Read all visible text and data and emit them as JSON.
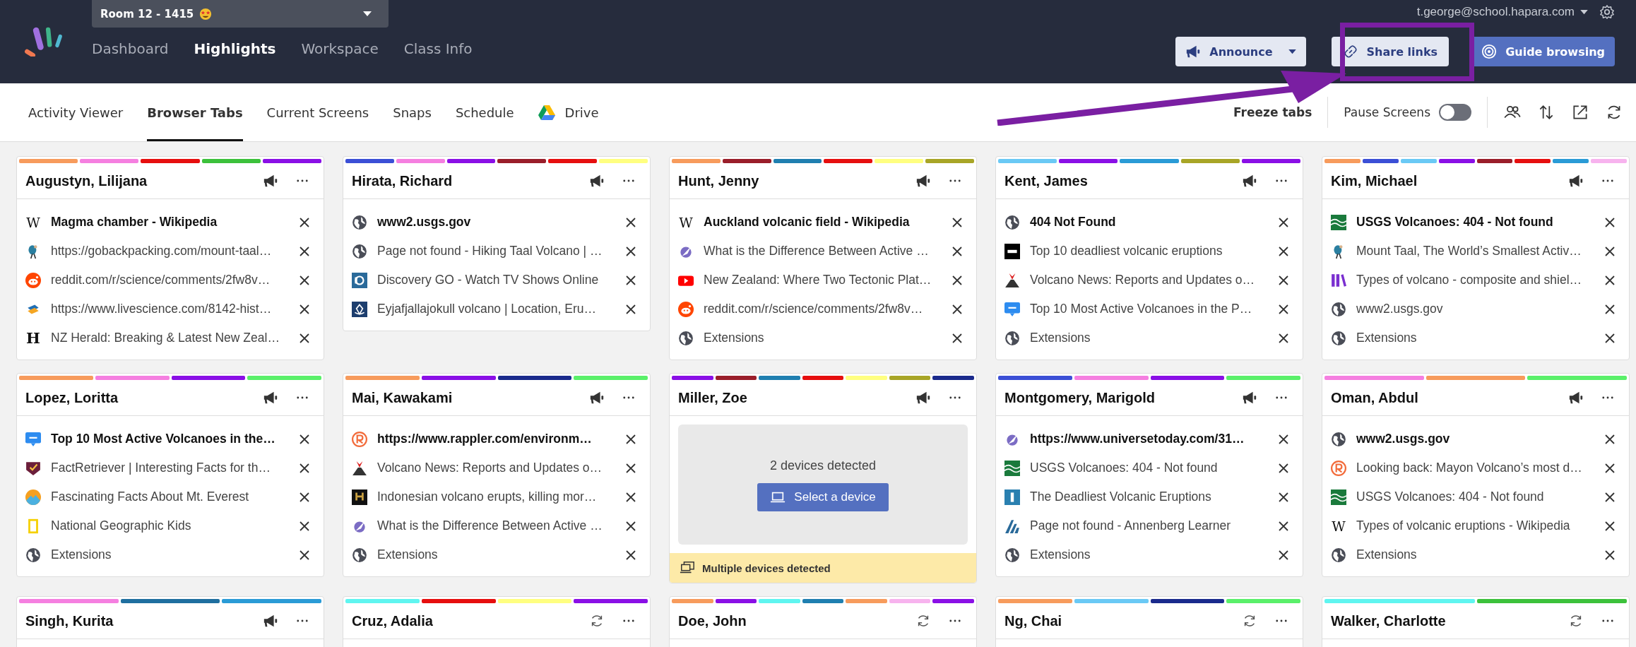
{
  "class_selector": {
    "value": "Room 12 - 1415"
  },
  "nav": [
    {
      "label": "Dashboard",
      "selected": false
    },
    {
      "label": "Highlights",
      "selected": true
    },
    {
      "label": "Workspace",
      "selected": false
    },
    {
      "label": "Class Info",
      "selected": false
    }
  ],
  "account": {
    "email": "t.george@school.hapara.com"
  },
  "actions": [
    {
      "kind": "announce",
      "label": "Announce"
    },
    {
      "kind": "share",
      "label": "Share links"
    },
    {
      "kind": "guide",
      "label": "Guide browsing"
    }
  ],
  "tabs": [
    {
      "label": "Activity Viewer",
      "selected": false,
      "kind": "plain"
    },
    {
      "label": "Browser Tabs",
      "selected": true,
      "kind": "plain"
    },
    {
      "label": "Current Screens",
      "selected": false,
      "kind": "plain"
    },
    {
      "label": "Snaps",
      "selected": false,
      "kind": "plain"
    },
    {
      "label": "Schedule",
      "selected": false,
      "kind": "plain"
    },
    {
      "label": "Drive",
      "selected": false,
      "kind": "drive"
    }
  ],
  "toolbar": {
    "freeze_label": "Freeze tabs",
    "pause_label": "Pause Screens",
    "pause_on": false
  },
  "students": [
    {
      "name": "Augustyn, Lilijana",
      "syncing": false,
      "kind": "tabs",
      "stripes": [
        {
          "color": "#f79b5c"
        },
        {
          "color": "#f57fe0"
        },
        {
          "color": "#e60e0e"
        },
        {
          "color": "#3cc13b"
        },
        {
          "color": "#8a0fe6"
        }
      ],
      "tabs": [
        {
          "title": "Magma chamber - Wikipedia",
          "kind": "wiki",
          "glyph": "W",
          "active": true
        },
        {
          "title": "https://gobackpacking.com/mount-taal…",
          "kind": "backpack",
          "active": false
        },
        {
          "title": "reddit.com/r/science/comments/2fw8v…",
          "kind": "reddit",
          "active": false
        },
        {
          "title": "https://www.livescience.com/8142-hist…",
          "kind": "livescience",
          "active": false
        },
        {
          "title": "NZ Herald: Breaking & Latest New Zeal…",
          "kind": "herald",
          "glyph": "H",
          "active": false
        }
      ]
    },
    {
      "name": "Hirata, Richard",
      "syncing": false,
      "kind": "tabs",
      "stripes": [
        {
          "color": "#3b4fd6"
        },
        {
          "color": "#f57fe0"
        },
        {
          "color": "#8a0fe6"
        },
        {
          "color": "#9a1e2a"
        },
        {
          "color": "#e60e0e"
        },
        {
          "color": "#ffff80"
        }
      ],
      "tabs": [
        {
          "title": "www2.usgs.gov",
          "kind": "globe",
          "active": true
        },
        {
          "title": "Page not found - Hiking Taal Volcano | …",
          "kind": "globe",
          "active": false
        },
        {
          "title": "Discovery GO - Watch TV Shows Online",
          "kind": "discovery",
          "active": false
        },
        {
          "title": "Eyjafjallajokull volcano | Location, Eru…",
          "kind": "emblem",
          "active": false
        }
      ]
    },
    {
      "name": "Hunt, Jenny",
      "syncing": false,
      "kind": "tabs",
      "stripes": [
        {
          "color": "#f79b5c"
        },
        {
          "color": "#9a1e2a"
        },
        {
          "color": "#1f7fb0"
        },
        {
          "color": "#e60e0e"
        },
        {
          "color": "#ffff80"
        },
        {
          "color": "#a8a526"
        }
      ],
      "tabs": [
        {
          "title": "Auckland volcanic field - Wikipedia",
          "kind": "wiki",
          "glyph": "W",
          "active": true
        },
        {
          "title": "What is the Difference Between Active …",
          "kind": "rocket",
          "active": false
        },
        {
          "title": "New Zealand: Where Two Tectonic Plat…",
          "kind": "youtube",
          "active": false
        },
        {
          "title": "reddit.com/r/science/comments/2fw8v…",
          "kind": "reddit",
          "active": false
        },
        {
          "title": "Extensions",
          "kind": "globe",
          "active": false
        }
      ]
    },
    {
      "name": "Kent, James",
      "syncing": false,
      "kind": "tabs",
      "stripes": [
        {
          "color": "#6ac9f5"
        },
        {
          "color": "#8a0fe6"
        },
        {
          "color": "#2a9bd6"
        },
        {
          "color": "#a8a526"
        },
        {
          "color": "#8a0fe6"
        }
      ],
      "tabs": [
        {
          "title": "404 Not Found",
          "kind": "globe",
          "active": true
        },
        {
          "title": "Top 10 deadliest volcanic eruptions",
          "kind": "hd",
          "active": false
        },
        {
          "title": "Volcano News: Reports and Updates o…",
          "kind": "volcano",
          "active": false
        },
        {
          "title": "Top 10 Most Active Volcanoes in the P…",
          "kind": "chat",
          "active": false
        },
        {
          "title": "Extensions",
          "kind": "globe",
          "active": false
        }
      ]
    },
    {
      "name": "Kim, Michael",
      "syncing": false,
      "kind": "tabs",
      "stripes": [
        {
          "color": "#f79b5c"
        },
        {
          "color": "#3b4fd6"
        },
        {
          "color": "#6ac9f5"
        },
        {
          "color": "#8a0fe6"
        },
        {
          "color": "#9a1e2a"
        },
        {
          "color": "#e60e0e"
        },
        {
          "color": "#2a9bd6"
        },
        {
          "color": "#f7b3ee"
        }
      ],
      "tabs": [
        {
          "title": "USGS Volcanoes: 404 - Not found",
          "kind": "usgs",
          "active": true
        },
        {
          "title": "Mount Taal, The World’s Smallest Activ…",
          "kind": "backpack",
          "active": false
        },
        {
          "title": "Types of volcano - composite and shiel…",
          "kind": "books",
          "active": false
        },
        {
          "title": "www2.usgs.gov",
          "kind": "globe",
          "active": false
        },
        {
          "title": "Extensions",
          "kind": "globe",
          "active": false
        }
      ]
    },
    {
      "name": "Lopez, Loritta",
      "syncing": false,
      "kind": "tabs",
      "stripes": [
        {
          "color": "#f79b5c"
        },
        {
          "color": "#f57fe0"
        },
        {
          "color": "#8a0fe6"
        },
        {
          "color": "#5af06a"
        }
      ],
      "tabs": [
        {
          "title": "Top 10 Most Active Volcanoes in the…",
          "kind": "chat",
          "active": true
        },
        {
          "title": "FactRetriever | Interesting Facts for th…",
          "kind": "fact",
          "active": false
        },
        {
          "title": "Fascinating Facts About Mt. Everest",
          "kind": "mountain",
          "active": false
        },
        {
          "title": "National Geographic Kids",
          "kind": "frame",
          "active": false
        },
        {
          "title": "Extensions",
          "kind": "globe",
          "active": false
        }
      ]
    },
    {
      "name": "Mai, Kawakami",
      "syncing": false,
      "kind": "tabs",
      "stripes": [
        {
          "color": "#f79b5c"
        },
        {
          "color": "#8a0fe6"
        },
        {
          "color": "#1a2a8c"
        },
        {
          "color": "#5af06a"
        }
      ],
      "tabs": [
        {
          "title": "https://www.rappler.com/environm…",
          "kind": "rappler",
          "active": true
        },
        {
          "title": "Volcano News: Reports and Updates o…",
          "kind": "volcano",
          "active": false
        },
        {
          "title": "Indonesian volcano erupts, killing mor…",
          "kind": "history",
          "active": false
        },
        {
          "title": "What is the Difference Between Active …",
          "kind": "rocket",
          "active": false
        },
        {
          "title": "Extensions",
          "kind": "globe",
          "active": false
        }
      ]
    },
    {
      "name": "Miller, Zoe",
      "syncing": false,
      "kind": "devices",
      "stripes": [
        {
          "color": "#8a0fe6"
        },
        {
          "color": "#9a1e2a"
        },
        {
          "color": "#1f7fb0"
        },
        {
          "color": "#e60e0e"
        },
        {
          "color": "#ffff80"
        },
        {
          "color": "#a8a526"
        },
        {
          "color": "#1a2a8c"
        }
      ],
      "message": "2 devices detected",
      "button": "Select a device",
      "notice": "Multiple devices detected"
    },
    {
      "name": "Montgomery, Marigold",
      "syncing": false,
      "kind": "tabs",
      "stripes": [
        {
          "color": "#3b4fd6"
        },
        {
          "color": "#f57fe0"
        },
        {
          "color": "#8a0fe6"
        },
        {
          "color": "#5af06a"
        }
      ],
      "tabs": [
        {
          "title": "https://www.universetoday.com/31…",
          "kind": "rocket",
          "active": true
        },
        {
          "title": "USGS Volcanoes: 404 - Not found",
          "kind": "usgs",
          "active": false
        },
        {
          "title": "The Deadliest Volcanic Eruptions",
          "kind": "bar",
          "active": false
        },
        {
          "title": "Page not found - Annenberg Learner",
          "kind": "annenberg",
          "active": false
        },
        {
          "title": "Extensions",
          "kind": "globe",
          "active": false
        }
      ]
    },
    {
      "name": "Oman, Abdul",
      "syncing": false,
      "kind": "tabs",
      "stripes": [
        {
          "color": "#f57fe0"
        },
        {
          "color": "#f79b5c"
        },
        {
          "color": "#5af06a"
        }
      ],
      "tabs": [
        {
          "title": "www2.usgs.gov",
          "kind": "globe",
          "active": true
        },
        {
          "title": "Looking back: Mayon Volcano’s most d…",
          "kind": "rappler",
          "active": false
        },
        {
          "title": "USGS Volcanoes: 404 - Not found",
          "kind": "usgs",
          "active": false
        },
        {
          "title": "Types of volcanic eruptions - Wikipedia",
          "kind": "wiki",
          "glyph": "W",
          "active": false
        },
        {
          "title": "Extensions",
          "kind": "globe",
          "active": false
        }
      ]
    },
    {
      "name": "Singh, Kurita",
      "syncing": false,
      "kind": "tabs",
      "stripes": [
        {
          "color": "#f57fe0"
        },
        {
          "color": "#1f6f9f"
        },
        {
          "color": "#2a9bd6"
        }
      ]
    },
    {
      "name": "Cruz, Adalia",
      "syncing": true,
      "kind": "tabs",
      "stripes": [
        {
          "color": "#5ff5f0"
        },
        {
          "color": "#e60e0e"
        },
        {
          "color": "#ffff80"
        },
        {
          "color": "#8a0fe6"
        }
      ]
    },
    {
      "name": "Doe, John",
      "syncing": true,
      "kind": "tabs",
      "stripes": [
        {
          "color": "#f79b5c"
        },
        {
          "color": "#8a0fe6"
        },
        {
          "color": "#5ff5f0"
        },
        {
          "color": "#1f7fb0"
        },
        {
          "color": "#f79b5c"
        },
        {
          "color": "#f7b3ee"
        },
        {
          "color": "#8a0fe6"
        }
      ]
    },
    {
      "name": "Ng, Chai",
      "syncing": true,
      "kind": "tabs",
      "stripes": [
        {
          "color": "#f79b5c"
        },
        {
          "color": "#6ac9f5"
        },
        {
          "color": "#1a2a8c"
        },
        {
          "color": "#5af06a"
        }
      ]
    },
    {
      "name": "Walker, Charlotte",
      "syncing": true,
      "kind": "tabs",
      "stripes": [
        {
          "color": "#5ff5f0"
        },
        {
          "color": "#3cc13b"
        }
      ]
    }
  ]
}
